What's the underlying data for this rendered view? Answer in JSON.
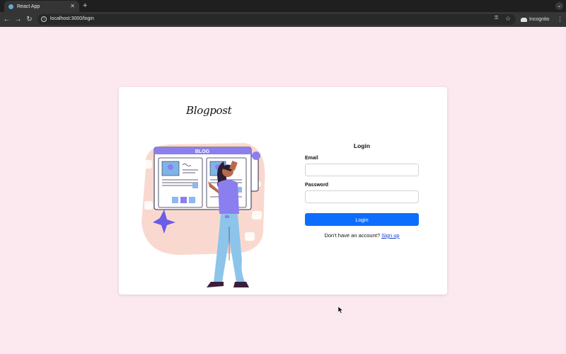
{
  "browser": {
    "tab_title": "React App",
    "url": "localhost:3000/login",
    "mode_label": "Incognito"
  },
  "brand": {
    "logo_text": "Blogpost"
  },
  "illustration": {
    "screen_label": "BLOG"
  },
  "login": {
    "title": "Login",
    "email_label": "Email",
    "email_value": "",
    "password_label": "Password",
    "password_value": "",
    "submit_label": "Login",
    "signup_prompt": "Don't have an account?",
    "signup_link": "Sign up"
  },
  "colors": {
    "page_bg": "#fbe9ef",
    "primary": "#0d6efd",
    "illustration_accent": "#8b7ff0",
    "illustration_blob": "#f9d9cf"
  }
}
